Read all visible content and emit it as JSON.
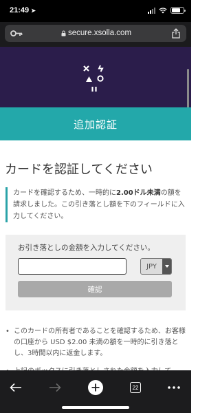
{
  "status_bar": {
    "time": "21:49"
  },
  "browser": {
    "url": "secure.xsolla.com"
  },
  "page": {
    "header_title": "追加認証",
    "card_title": "カードを認証してください",
    "note_text_1": "カードを確認するため、一時的に",
    "note_text_bold": "2.00ドル未満",
    "note_text_2": "の額を請求しました。この引き落とし額を下のフィールドに入力してください。",
    "form": {
      "label": "お引き落としの金額を入力してください。",
      "amount_value": "",
      "currency": "JPY",
      "submit_label": "確認"
    },
    "bullets": [
      "このカードの所有者であることを確認するため、お客様の口座から USD $2.00 未満の額を一時的に引き落とし、3時間以内に返金します。",
      "上記のボックスに引き落としされた金額を入力して"
    ]
  },
  "toolbar": {
    "tab_count": "22"
  },
  "colors": {
    "brand_header": "#2b1d4b",
    "accent": "#23a8aa",
    "button_disabled": "#a9a9a9"
  },
  "icons": [
    "key-icon",
    "lock-icon",
    "share-icon",
    "xsolla-logo",
    "back-icon",
    "forward-icon",
    "new-tab-icon",
    "tabs-icon",
    "more-icon"
  ]
}
